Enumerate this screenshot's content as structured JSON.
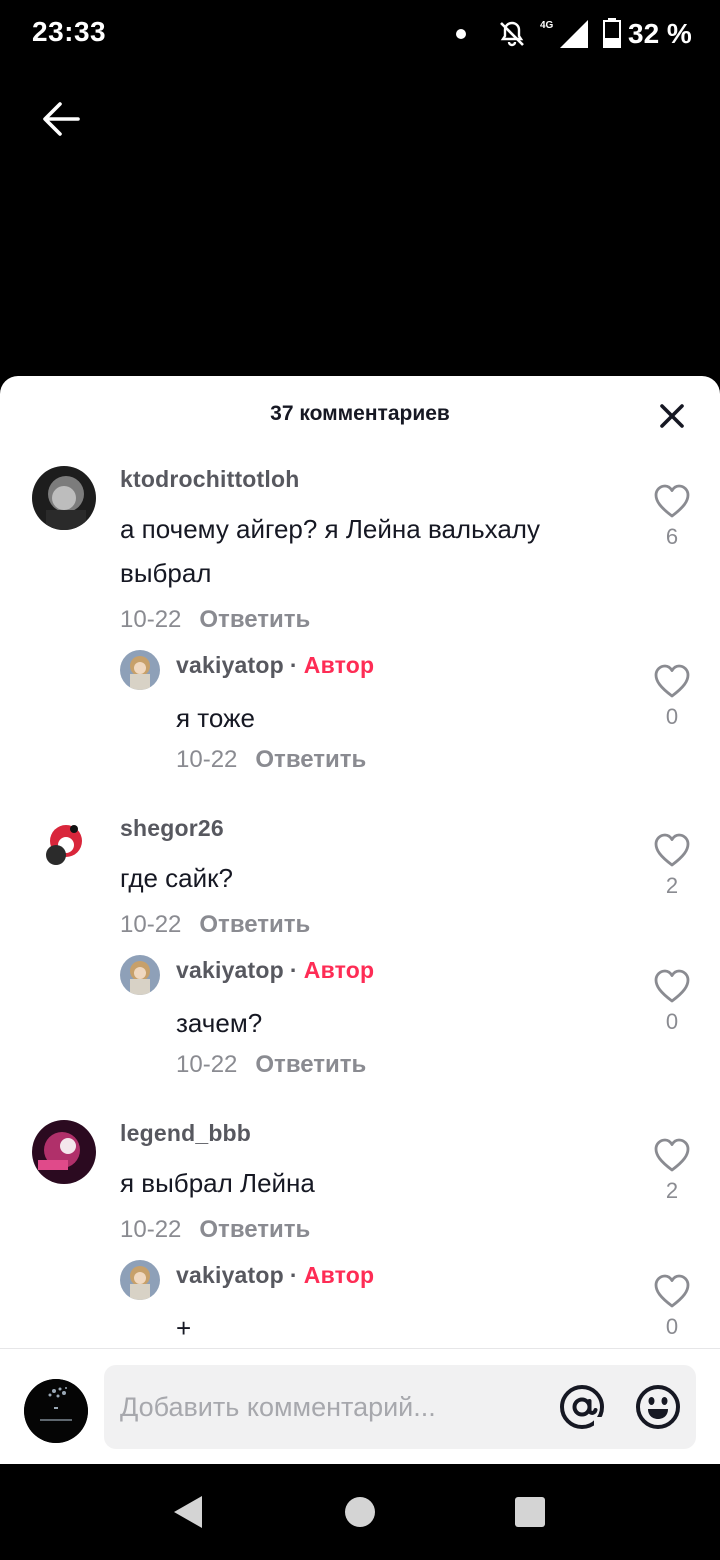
{
  "status_bar": {
    "time": "23:33",
    "battery_text": "32 %",
    "network": "4G",
    "icons": [
      "dot-icon",
      "bell-off-icon",
      "signal-icon",
      "battery-icon"
    ]
  },
  "header": {
    "back_icon": "back-arrow-icon"
  },
  "sheet": {
    "title": "37 комментариев",
    "close_icon": "close-icon"
  },
  "comments": [
    {
      "username": "ktodrochittotloh",
      "text": "а почему айгер? я Лейна вальхалу выбрал",
      "date": "10-22",
      "reply_label": "Ответить",
      "likes": "6",
      "is_reply": false,
      "avatar_color": "#3a3a3a"
    },
    {
      "username": "vakiyatop",
      "author_label": "Автор",
      "text": "я тоже",
      "date": "10-22",
      "reply_label": "Ответить",
      "likes": "0",
      "is_reply": true,
      "avatar_color": "#c7a06a"
    },
    {
      "username": "shegor26",
      "text": "где сайк?",
      "date": "10-22",
      "reply_label": "Ответить",
      "likes": "2",
      "is_reply": false,
      "avatar_color": "#d9263b"
    },
    {
      "username": "vakiyatop",
      "author_label": "Автор",
      "text": "зачем?",
      "date": "10-22",
      "reply_label": "Ответить",
      "likes": "0",
      "is_reply": true,
      "avatar_color": "#c7a06a"
    },
    {
      "username": "legend_bbb",
      "text": "я выбрал Лейна",
      "date": "10-22",
      "reply_label": "Ответить",
      "likes": "2",
      "is_reply": false,
      "avatar_color": "#b0306a"
    },
    {
      "username": "vakiyatop",
      "author_label": "Автор",
      "text": "+",
      "date": "",
      "reply_label": "",
      "likes": "0",
      "is_reply": true,
      "avatar_color": "#c7a06a"
    }
  ],
  "input_bar": {
    "placeholder": "Добавить комментарий...",
    "mention_icon": "at-icon",
    "emoji_icon": "emoji-icon"
  },
  "nav_bar": {
    "icons": [
      "nav-back-icon",
      "nav-home-icon",
      "nav-recents-icon"
    ]
  },
  "colors": {
    "accent": "#fe2c55",
    "text": "#161823",
    "secondary": "#8a8b91",
    "background": "#000000",
    "sheet": "#ffffff"
  }
}
